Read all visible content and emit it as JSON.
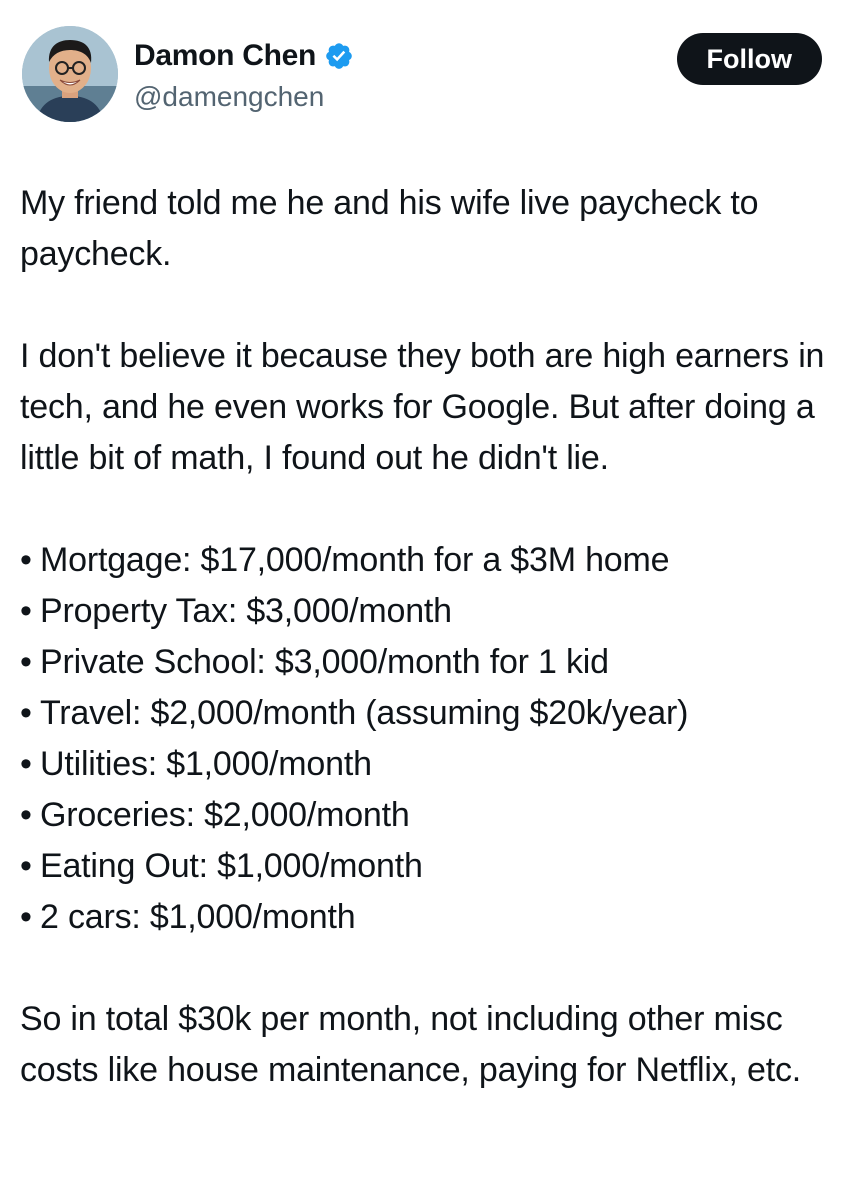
{
  "author": {
    "name": "Damon Chen",
    "handle": "@damengchen",
    "verified": true,
    "verified_color": "#1d9bf0"
  },
  "follow_button": {
    "label": "Follow"
  },
  "tweet": {
    "intro": "My friend told me he and his wife live paycheck to paycheck.",
    "paragraph2": "I don't believe it because they both are high earners in tech, and he even works for Google. But after doing a little bit of math, I found out he didn't lie.",
    "bullet_char": "•",
    "bullets": [
      "Mortgage: $17,000/month for a $3M home",
      "Property Tax: $3,000/month",
      "Private School: $3,000/month for 1 kid",
      "Travel: $2,000/month (assuming $20k/year)",
      "Utilities: $1,000/month",
      "Groceries: $2,000/month",
      "Eating Out: $1,000/month",
      "2 cars: $1,000/month"
    ],
    "conclusion": "So in total $30k per month, not including other misc costs like house maintenance, paying for Netflix, etc."
  }
}
